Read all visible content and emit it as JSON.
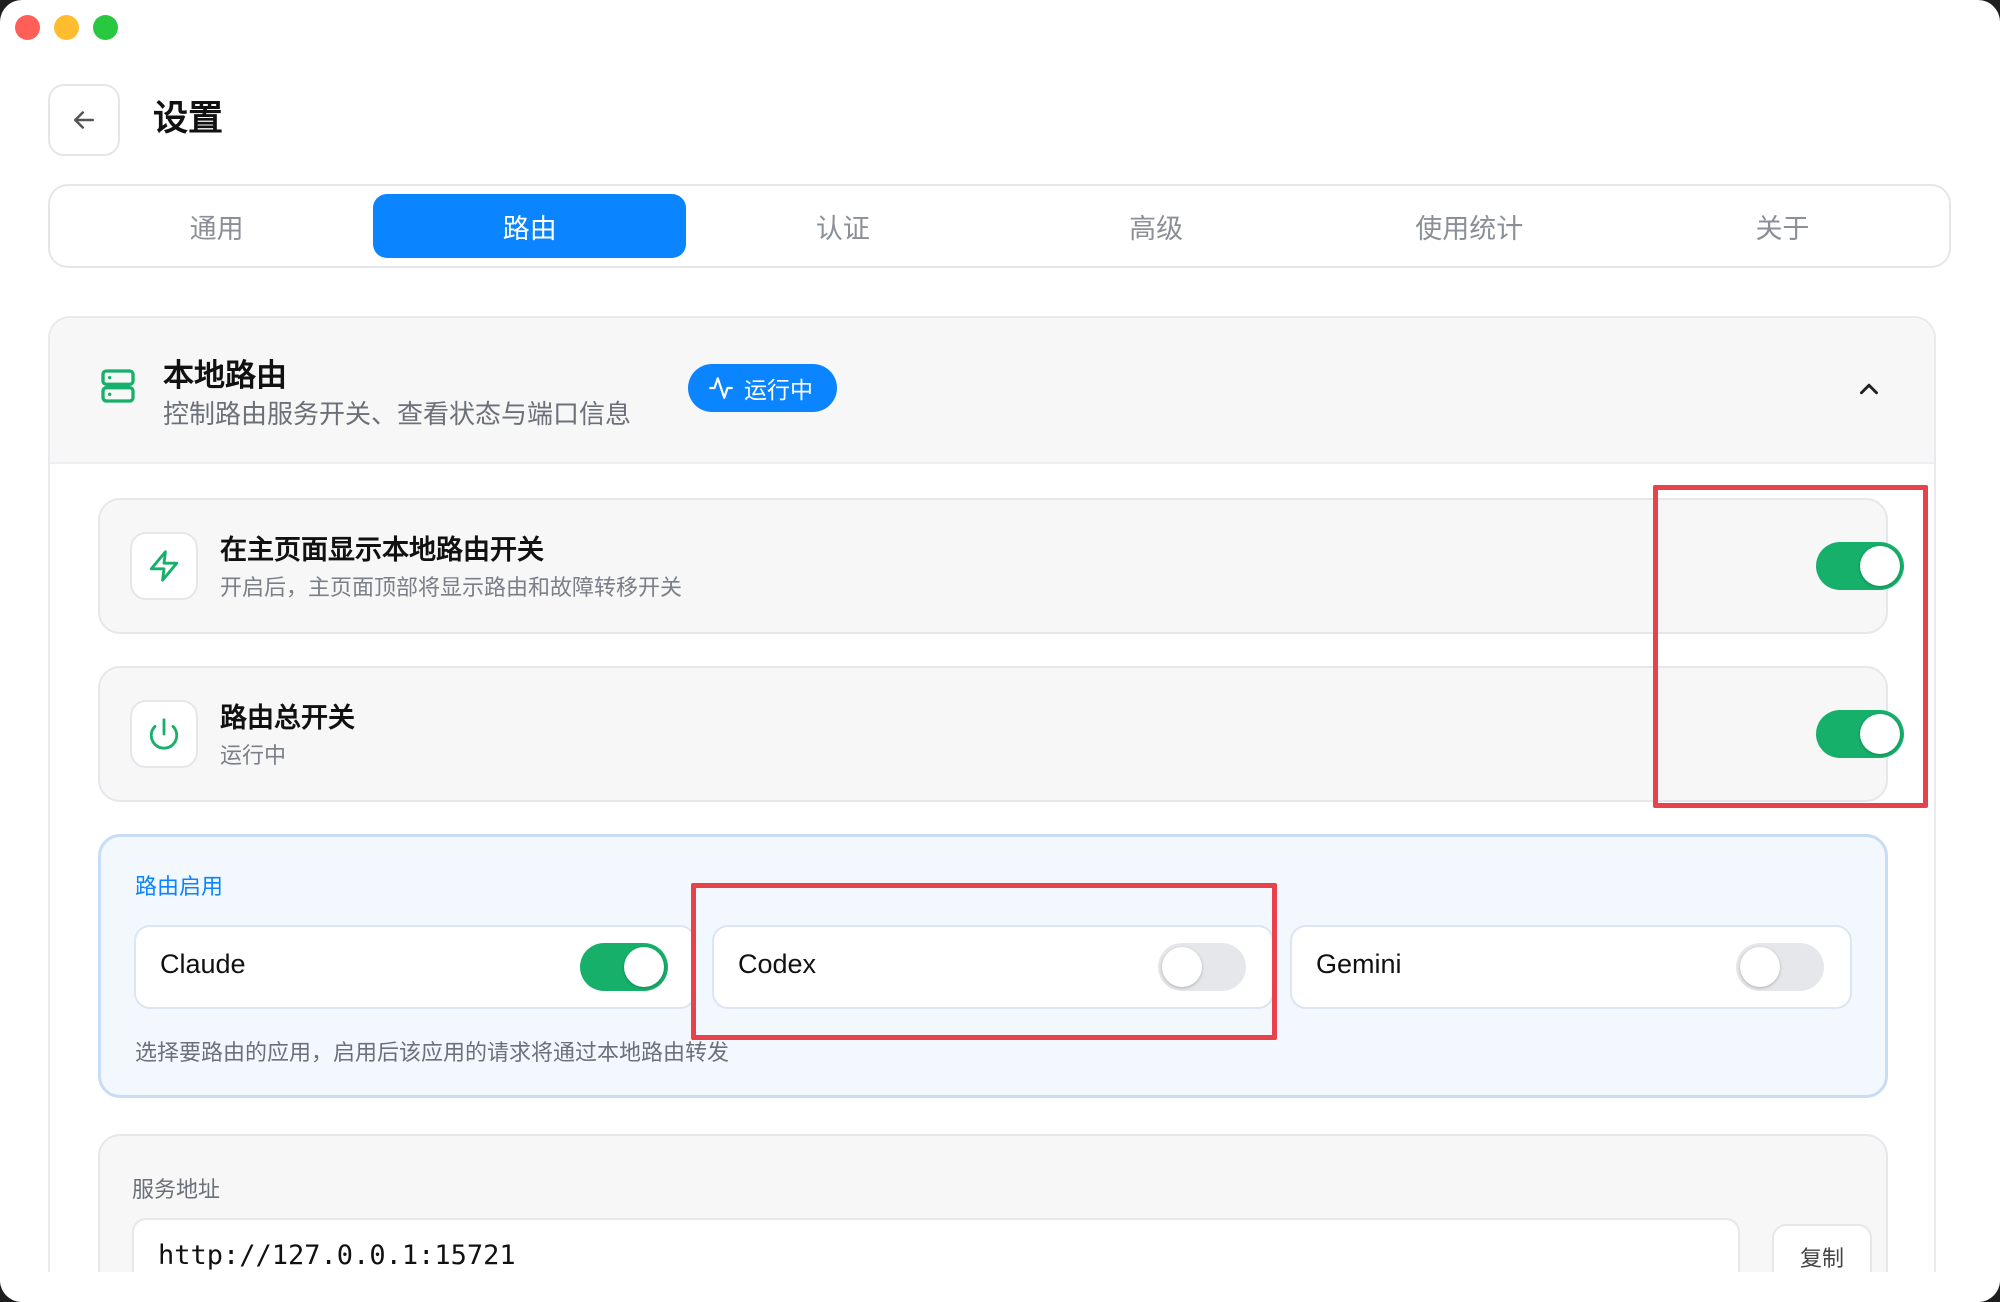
{
  "window": {
    "controls": [
      "close",
      "minimize",
      "maximize"
    ],
    "colors": {
      "close": "#ff5f57",
      "minimize": "#febc2e",
      "maximize": "#28c840"
    }
  },
  "header": {
    "back_icon": "arrow-left-icon",
    "title": "设置"
  },
  "tabs": [
    {
      "label": "通用",
      "active": false
    },
    {
      "label": "路由",
      "active": true
    },
    {
      "label": "认证",
      "active": false
    },
    {
      "label": "高级",
      "active": false
    },
    {
      "label": "使用统计",
      "active": false
    },
    {
      "label": "关于",
      "active": false
    }
  ],
  "section": {
    "icon": "server-icon",
    "title": "本地路由",
    "description": "控制路由服务开关、查看状态与端口信息",
    "status_icon": "activity-icon",
    "status": "运行中",
    "collapse_icon": "chevron-up-icon"
  },
  "settings": [
    {
      "icon": "lightning-icon",
      "title": "在主页面显示本地路由开关",
      "description": "开启后，主页面顶部将显示路由和故障转移开关",
      "enabled": true
    },
    {
      "icon": "power-icon",
      "title": "路由总开关",
      "description": "运行中",
      "enabled": true
    }
  ],
  "routing": {
    "label": "路由启用",
    "apps": [
      {
        "name": "Claude",
        "enabled": true
      },
      {
        "name": "Codex",
        "enabled": false
      },
      {
        "name": "Gemini",
        "enabled": false
      }
    ],
    "note": "选择要路由的应用，启用后该应用的请求将通过本地路由转发"
  },
  "service": {
    "label": "服务地址",
    "address": "http://127.0.0.1:15721",
    "copy_label": "复制"
  },
  "colors": {
    "accent": "#0a84ff",
    "toggle_on": "#16b06a",
    "highlight": "#e8434c"
  }
}
